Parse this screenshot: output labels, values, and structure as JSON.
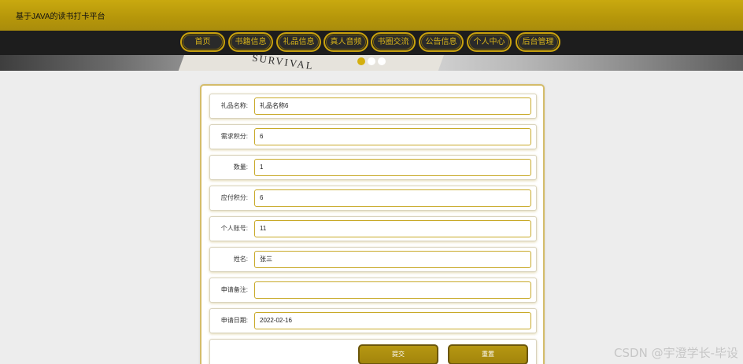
{
  "header": {
    "site_title": "基于JAVA的读书打卡平台"
  },
  "nav": {
    "items": [
      {
        "label": "首页"
      },
      {
        "label": "书籍信息"
      },
      {
        "label": "礼品信息"
      },
      {
        "label": "真人音频"
      },
      {
        "label": "书圈交流"
      },
      {
        "label": "公告信息"
      },
      {
        "label": "个人中心"
      },
      {
        "label": "后台管理"
      }
    ]
  },
  "banner": {
    "text": "SURVIVAL"
  },
  "form": {
    "rows": [
      {
        "label": "礼品名称:",
        "value": "礼品名称6"
      },
      {
        "label": "需求积分:",
        "value": "6"
      },
      {
        "label": "数量:",
        "value": "1"
      },
      {
        "label": "应付积分:",
        "value": "6"
      },
      {
        "label": "个人账号:",
        "value": "11"
      },
      {
        "label": "姓名:",
        "value": "张三"
      },
      {
        "label": "申请备注:",
        "value": ""
      },
      {
        "label": "申请日期:",
        "value": "2022-02-16"
      }
    ],
    "submit_label": "提交",
    "reset_label": "重置"
  },
  "colors": {
    "accent": "#c9a90f",
    "nav_bg": "#1d1d1d"
  },
  "watermark": "CSDN @宇澄学长-毕设"
}
